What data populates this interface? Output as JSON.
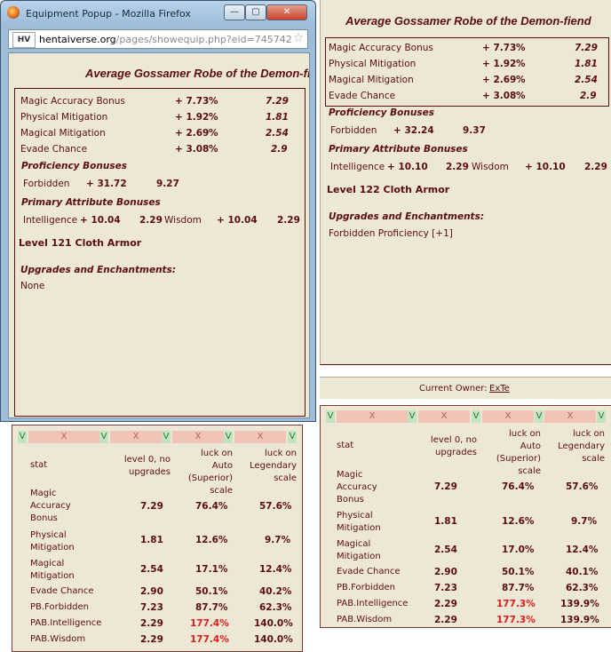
{
  "window": {
    "title": "Equipment Popup - Mozilla Firefox",
    "url_domain": "hentaiverse.org",
    "url_path": "/pages/showequip.php?eid=745742",
    "min_label": "—",
    "max_label": "▢",
    "close_label": "✕"
  },
  "popup_item": {
    "title": "Average Gossamer Robe of the Demon-fiend",
    "stats": [
      {
        "name": "Magic Accuracy Bonus",
        "value": "+ 7.73",
        "unit": "%",
        "base": "7.29"
      },
      {
        "name": "Physical Mitigation",
        "value": "+ 1.92",
        "unit": "%",
        "base": "1.81"
      },
      {
        "name": "Magical Mitigation",
        "value": "+ 2.69",
        "unit": "%",
        "base": "2.54"
      },
      {
        "name": "Evade Chance",
        "value": "+ 3.08",
        "unit": "%",
        "base": "2.9"
      }
    ],
    "proficiency_header": "Proficiency Bonuses",
    "proficiency": {
      "name": "Forbidden",
      "value": "+ 31.72",
      "base": "9.27"
    },
    "pab_header": "Primary Attribute Bonuses",
    "pab": [
      {
        "name": "Intelligence",
        "value": "+ 10.04",
        "base": "2.29"
      },
      {
        "name": "Wisdom",
        "value": "+ 10.04",
        "base": "2.29"
      }
    ],
    "level": "Level 121 Cloth Armor",
    "upgrades_header": "Upgrades and Enchantments:",
    "upgrades": "None"
  },
  "page_item": {
    "title": "Average Gossamer Robe of the Demon-fiend",
    "stats": [
      {
        "name": "Magic Accuracy Bonus",
        "value": "+ 7.73",
        "unit": "%",
        "base": "7.29"
      },
      {
        "name": "Physical Mitigation",
        "value": "+ 1.92",
        "unit": "%",
        "base": "1.81"
      },
      {
        "name": "Magical Mitigation",
        "value": "+ 2.69",
        "unit": "%",
        "base": "2.54"
      },
      {
        "name": "Evade Chance",
        "value": "+ 3.08",
        "unit": "%",
        "base": "2.9"
      }
    ],
    "proficiency_header": "Proficiency Bonuses",
    "proficiency": {
      "name": "Forbidden",
      "value": "+ 32.24",
      "base": "9.37"
    },
    "pab_header": "Primary Attribute Bonuses",
    "pab": [
      {
        "name": "Intelligence",
        "value": "+ 10.10",
        "base": "2.29"
      },
      {
        "name": "Wisdom",
        "value": "+ 10.10",
        "base": "2.29"
      }
    ],
    "level": "Level 122 Cloth Armor",
    "upgrades_header": "Upgrades and Enchantments:",
    "upgrades": "Forbidden Proficiency [+1]"
  },
  "owner": {
    "label": "Current Owner:",
    "name": "ExTe"
  },
  "controls": {
    "v": "V",
    "x": "X"
  },
  "left_table": {
    "headers": {
      "stat": "stat",
      "col1": "level 0, no upgrades",
      "col2": "luck on Auto (Superior) scale",
      "col3": "luck on Legendary scale"
    },
    "rows": [
      {
        "stat": "Magic Accuracy Bonus",
        "c1": "7.29",
        "c2": "76.4%",
        "c3": "57.6%",
        "red": false
      },
      {
        "stat": "Physical Mitigation",
        "c1": "1.81",
        "c2": "12.6%",
        "c3": "9.7%",
        "red": false
      },
      {
        "stat": "Magical Mitigation",
        "c1": "2.54",
        "c2": "17.1%",
        "c3": "12.4%",
        "red": false
      },
      {
        "stat": "Evade Chance",
        "c1": "2.90",
        "c2": "50.1%",
        "c3": "40.2%",
        "red": false
      },
      {
        "stat": "PB.Forbidden",
        "c1": "7.23",
        "c2": "87.7%",
        "c3": "62.3%",
        "red": false
      },
      {
        "stat": "PAB.Intelligence",
        "c1": "2.29",
        "c2": "177.4%",
        "c3": "140.0%",
        "red": true
      },
      {
        "stat": "PAB.Wisdom",
        "c1": "2.29",
        "c2": "177.4%",
        "c3": "140.0%",
        "red": true
      }
    ]
  },
  "right_table": {
    "headers": {
      "stat": "stat",
      "col1": "level 0, no upgrades",
      "col2": "luck on Auto (Superior) scale",
      "col3": "luck on Legendary scale"
    },
    "rows": [
      {
        "stat": "Magic Accuracy Bonus",
        "c1": "7.29",
        "c2": "76.4%",
        "c3": "57.6%",
        "red": false
      },
      {
        "stat": "Physical Mitigation",
        "c1": "1.81",
        "c2": "12.6%",
        "c3": "9.7%",
        "red": false
      },
      {
        "stat": "Magical Mitigation",
        "c1": "2.54",
        "c2": "17.0%",
        "c3": "12.4%",
        "red": false
      },
      {
        "stat": "Evade Chance",
        "c1": "2.90",
        "c2": "50.1%",
        "c3": "40.1%",
        "red": false
      },
      {
        "stat": "PB.Forbidden",
        "c1": "7.23",
        "c2": "87.7%",
        "c3": "62.3%",
        "red": false
      },
      {
        "stat": "PAB.Intelligence",
        "c1": "2.29",
        "c2": "177.3%",
        "c3": "139.9%",
        "red": true
      },
      {
        "stat": "PAB.Wisdom",
        "c1": "2.29",
        "c2": "177.3%",
        "c3": "139.9%",
        "red": true
      }
    ]
  },
  "colors": {
    "text": "#5c0d12",
    "panel": "#ede8d6",
    "highlight": "#e01b1b",
    "v_box": "#c4e3c0",
    "x_box": "#f2c4b8"
  }
}
